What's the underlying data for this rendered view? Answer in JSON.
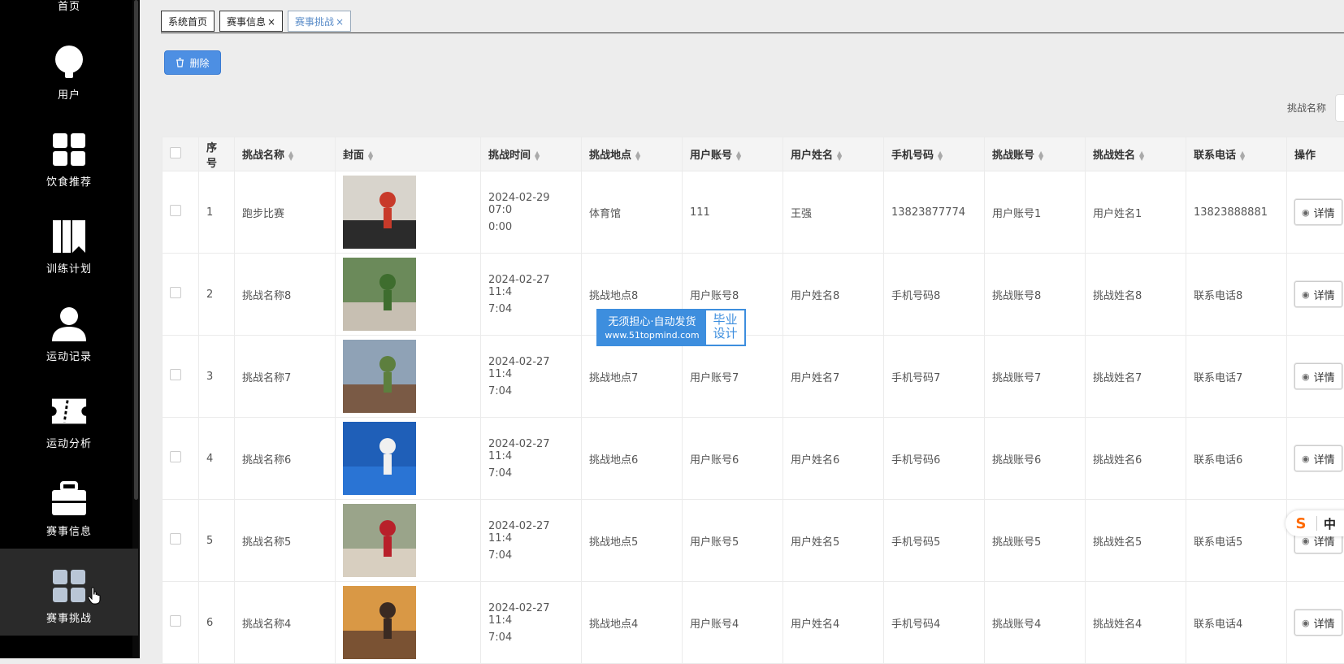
{
  "sidebar": {
    "items": [
      {
        "label": "首页",
        "icon": "home-icon"
      },
      {
        "label": "用户",
        "icon": "lightbulb-icon"
      },
      {
        "label": "饮食推荐",
        "icon": "grid-icon"
      },
      {
        "label": "训练计划",
        "icon": "book-icon"
      },
      {
        "label": "运动记录",
        "icon": "person-icon"
      },
      {
        "label": "运动分析",
        "icon": "ticket-icon"
      },
      {
        "label": "赛事信息",
        "icon": "briefcase-icon"
      },
      {
        "label": "赛事挑战",
        "icon": "grid-icon"
      }
    ],
    "active": "赛事挑战"
  },
  "tabs": [
    {
      "label": "系统首页",
      "closable": false
    },
    {
      "label": "赛事信息",
      "closable": true
    },
    {
      "label": "赛事挑战",
      "closable": true
    }
  ],
  "toolbar": {
    "delete_label": "删除",
    "close_glyph": "×"
  },
  "search": {
    "label": "挑战名称"
  },
  "table": {
    "headers": [
      "序号",
      "挑战名称",
      "封面",
      "挑战时间",
      "挑战地点",
      "用户账号",
      "用户姓名",
      "手机号码",
      "挑战账号",
      "挑战姓名",
      "联系电话",
      "操作"
    ],
    "action_label": "详情",
    "rows": [
      {
        "no": "1",
        "name": "跑步比赛",
        "time_a": "2024-02-29 07:0",
        "time_b": "0:00",
        "place": "体育馆",
        "account": "111",
        "username": "王强",
        "phone": "13823877774",
        "challenge_account": "用户账号1",
        "challenge_name": "用户姓名1",
        "contact": "13823888881"
      },
      {
        "no": "2",
        "name": "挑战名称8",
        "time_a": "2024-02-27 11:4",
        "time_b": "7:04",
        "place": "挑战地点8",
        "account": "用户账号8",
        "username": "用户姓名8",
        "phone": "手机号码8",
        "challenge_account": "挑战账号8",
        "challenge_name": "挑战姓名8",
        "contact": "联系电话8"
      },
      {
        "no": "3",
        "name": "挑战名称7",
        "time_a": "2024-02-27 11:4",
        "time_b": "7:04",
        "place": "挑战地点7",
        "account": "用户账号7",
        "username": "用户姓名7",
        "phone": "手机号码7",
        "challenge_account": "挑战账号7",
        "challenge_name": "挑战姓名7",
        "contact": "联系电话7"
      },
      {
        "no": "4",
        "name": "挑战名称6",
        "time_a": "2024-02-27 11:4",
        "time_b": "7:04",
        "place": "挑战地点6",
        "account": "用户账号6",
        "username": "用户姓名6",
        "phone": "手机号码6",
        "challenge_account": "挑战账号6",
        "challenge_name": "挑战姓名6",
        "contact": "联系电话6"
      },
      {
        "no": "5",
        "name": "挑战名称5",
        "time_a": "2024-02-27 11:4",
        "time_b": "7:04",
        "place": "挑战地点5",
        "account": "用户账号5",
        "username": "用户姓名5",
        "phone": "手机号码5",
        "challenge_account": "挑战账号5",
        "challenge_name": "挑战姓名5",
        "contact": "联系电话5"
      },
      {
        "no": "6",
        "name": "挑战名称4",
        "time_a": "2024-02-27 11:4",
        "time_b": "7:04",
        "place": "挑战地点4",
        "account": "用户账号4",
        "username": "用户姓名4",
        "phone": "手机号码4",
        "challenge_account": "挑战账号4",
        "challenge_name": "挑战姓名4",
        "contact": "联系电话4"
      }
    ]
  },
  "watermark": {
    "line1": "无须担心·自动发货",
    "url": "www.51topmind.com",
    "right1": "毕业",
    "right2": "设计"
  },
  "ime": {
    "logo": "S",
    "lang": "中"
  },
  "colors": {
    "primary": "#4d8fe3",
    "sidebar_bg": "#000000",
    "active_tab": "#5b8dc9"
  }
}
